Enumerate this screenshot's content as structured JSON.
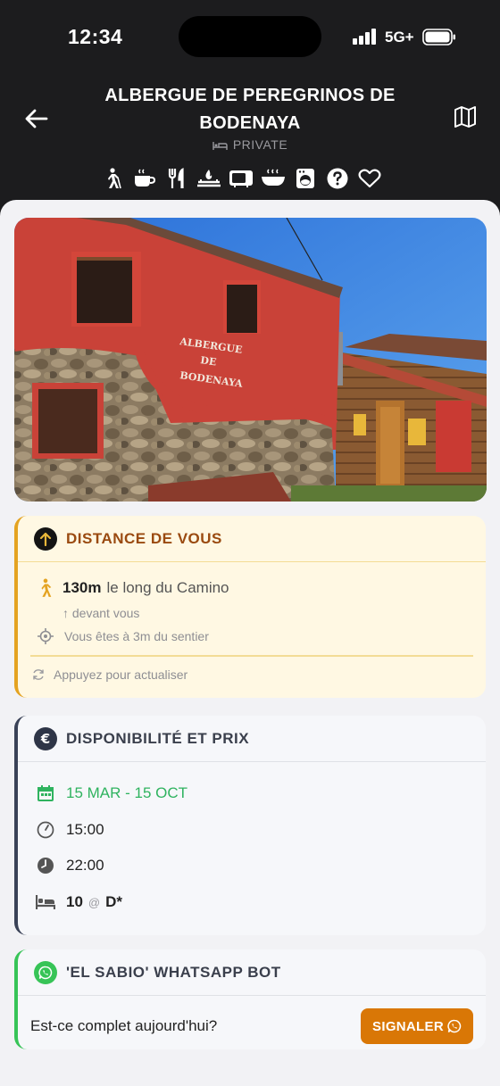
{
  "status_bar": {
    "time": "12:34",
    "network": "5G+"
  },
  "header": {
    "title": "ALBERGUE DE PEREGRINOS DE BODENAYA",
    "type": "PRIVATE",
    "amenities": [
      "walker-icon",
      "coffee-icon",
      "restaurant-icon",
      "stove-icon",
      "microwave-icon",
      "dinner-icon",
      "washer-icon",
      "help-icon",
      "favorite-icon"
    ]
  },
  "photo": {
    "sign_line1": "ALBERGUE",
    "sign_line2": "DE",
    "sign_line3": "BODENAYA"
  },
  "distance": {
    "title": "DISTANCE DE VOUS",
    "value": "130m",
    "along": "le long du Camino",
    "direction": "↑ devant vous",
    "trail": "Vous êtes à 3m du sentier",
    "refresh": "Appuyez pour actualiser",
    "accent": "#e4a321"
  },
  "availability": {
    "title": "DISPONIBILITÉ ET PRIX",
    "dates": "15 MAR - 15 OCT",
    "checkin": "15:00",
    "closing": "22:00",
    "beds": "10",
    "at": "@",
    "price": "D*",
    "accent": "#3a4257",
    "date_color": "#2fb35f"
  },
  "whatsapp": {
    "title": "'EL SABIO' WHATSAPP BOT",
    "question": "Est-ce complet aujourd'hui?",
    "button": "SIGNALER",
    "accent": "#37c457",
    "button_color": "#d97706"
  }
}
